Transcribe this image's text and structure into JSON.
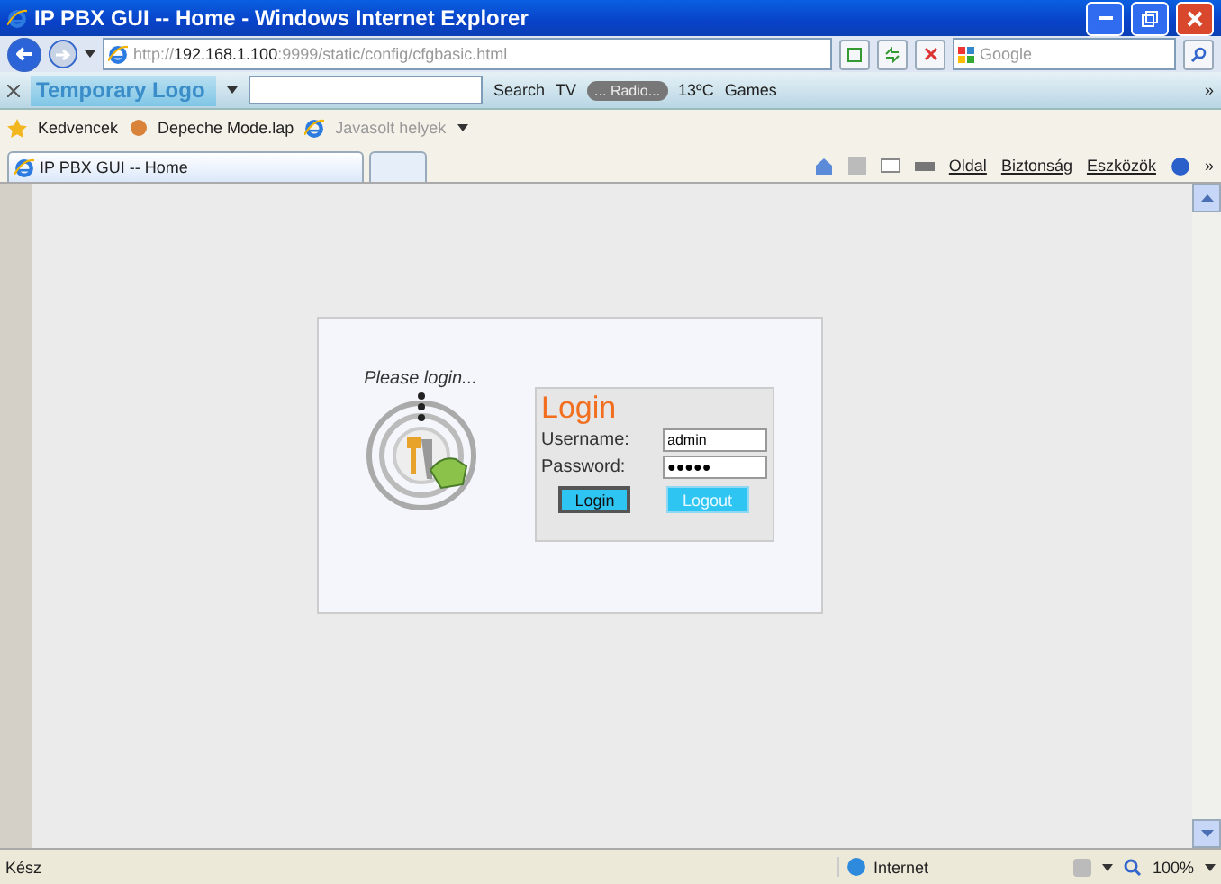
{
  "window": {
    "title": "IP PBX GUI -- Home - Windows Internet Explorer"
  },
  "address_bar": {
    "scheme": "http://",
    "host": "192.168.1.100",
    "path": ":9999/static/config/cfgbasic.html"
  },
  "search_box": {
    "placeholder": "Google"
  },
  "toolbar": {
    "logo": "Temporary Logo",
    "items": [
      {
        "label": "Search"
      },
      {
        "label": "TV"
      },
      {
        "label": "... Radio..."
      },
      {
        "label": "13ºC"
      },
      {
        "label": "Games"
      }
    ],
    "overflow": "»"
  },
  "favorites_bar": {
    "items": [
      {
        "label": "Kedvencek",
        "disabled": false
      },
      {
        "label": "Depeche Mode.lap",
        "disabled": false
      },
      {
        "label": "Javasolt helyek",
        "disabled": true
      }
    ]
  },
  "tabs": [
    {
      "label": "IP PBX GUI -- Home",
      "selected": true
    }
  ],
  "command_bar": {
    "menus": [
      "Oldal",
      "Biztonság",
      "Eszközök"
    ],
    "overflow": "»"
  },
  "page": {
    "prompt": "Please login...",
    "login": {
      "title": "Login",
      "username_label": "Username:",
      "username": "admin",
      "password_label": "Password:",
      "password": "●●●●●",
      "buttons": [
        {
          "label": "Login",
          "focused": true
        },
        {
          "label": "Logout",
          "focused": false
        }
      ]
    }
  },
  "status_bar": {
    "text": "Kész",
    "zone": "Internet",
    "zoom": "100%"
  }
}
